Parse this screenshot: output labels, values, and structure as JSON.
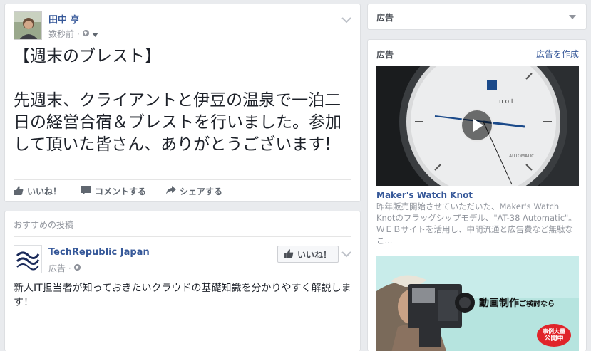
{
  "post": {
    "author": "田中 亨",
    "timestamp": "数秒前 ·",
    "text": "【週末のブレスト】\n\n先週末、クライアントと伊豆の温泉で一泊二日の経営合宿＆ブレストを行いました。参加して頂いた皆さん、ありがとうございます!",
    "actions": {
      "like": "いいね！",
      "comment": "コメントする",
      "share": "シェアする"
    }
  },
  "recommended": {
    "header": "おすすめの投稿",
    "page_name": "TechRepublic Japan",
    "meta": "広告 ·",
    "like_button": "いいね！",
    "text": "新人IT担当者が知っておきたいクラウドの基礎知識を分かりやすく解説します！"
  },
  "sidebar": {
    "ad_header_1": "広告",
    "ad_header_2": "広告",
    "create_ad": "広告を作成",
    "ad1": {
      "title": "Maker's Watch Knot",
      "description": "昨年販売開始させていただいた、Maker's Watch Knotのフラッグシップモデル、\"AT-38 Automatic\"。ＷＥＢサイトを活用し、中間流通と広告費など無駄なこ..."
    },
    "ad2": {
      "headline": "動画制作",
      "headline_small": "ご検討なら",
      "badge_line1": "事例大量",
      "badge_line2": "公開中"
    }
  },
  "colors": {
    "link": "#365899",
    "muted": "#90949c",
    "background": "#e9ebee"
  },
  "icons": [
    "globe-icon",
    "chevron-down-icon",
    "like-icon",
    "comment-icon",
    "share-icon",
    "play-icon",
    "caret-down-icon"
  ]
}
